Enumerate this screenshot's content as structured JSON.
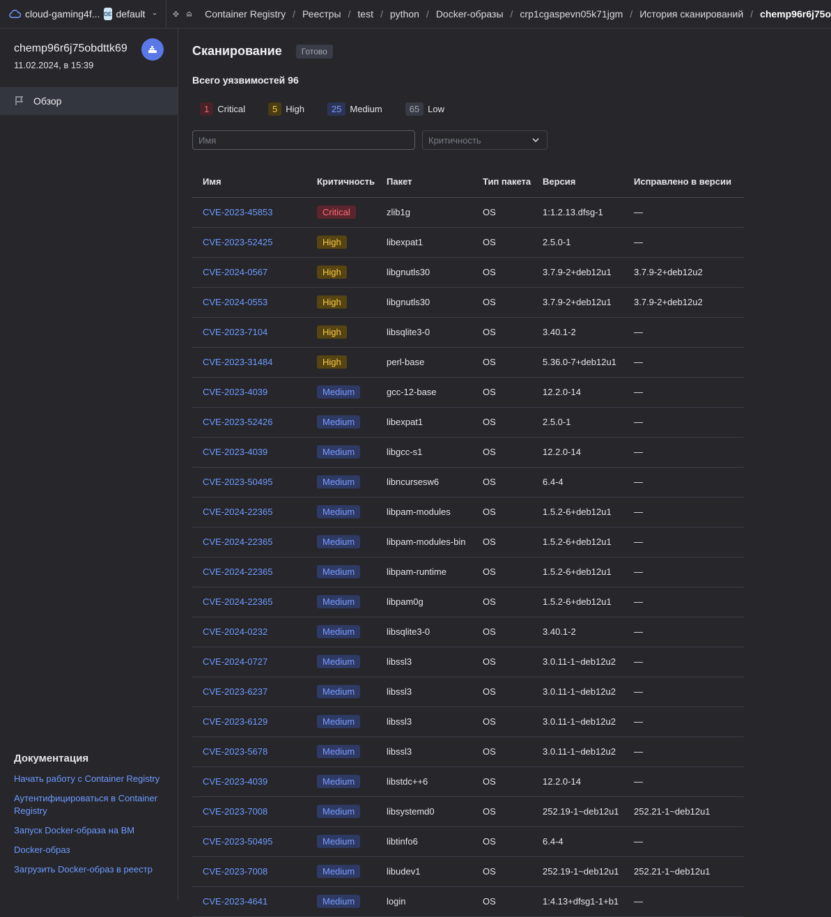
{
  "topbar": {
    "cloud_name": "cloud-gaming4f...",
    "folder_badge": "DE",
    "folder_name": "default",
    "breadcrumbs": [
      "Container Registry",
      "Реестры",
      "test",
      "python",
      "Docker-образы",
      "crp1cgaspevn05k71jgm",
      "История сканирований",
      "chemp96r6j75o"
    ]
  },
  "sidebar": {
    "title": "chemp96r6j75obdttk69",
    "date": "11.02.2024, в 15:39",
    "nav": [
      {
        "label": "Обзор",
        "icon": "flag-icon"
      }
    ],
    "docs": {
      "title": "Документация",
      "links": [
        "Начать работу с Container Registry",
        "Аутентифицироваться в Container Registry",
        "Запуск Docker-образа на ВМ",
        "Docker-образ",
        "Загрузить Docker-образ в реестр"
      ]
    }
  },
  "main": {
    "title": "Сканирование",
    "status": "Готово",
    "total": "Всего уязвимостей 96",
    "counts": [
      {
        "num": "1",
        "label": "Critical",
        "cls": "c-crit"
      },
      {
        "num": "5",
        "label": "High",
        "cls": "c-high"
      },
      {
        "num": "25",
        "label": "Medium",
        "cls": "c-med"
      },
      {
        "num": "65",
        "label": "Low",
        "cls": "c-low"
      }
    ],
    "filters": {
      "name_placeholder": "Имя",
      "severity_placeholder": "Критичность"
    },
    "table": {
      "headers": [
        "Имя",
        "Критичность",
        "Пакет",
        "Тип пакета",
        "Версия",
        "Исправлено в версии"
      ],
      "rows": [
        [
          "CVE-2023-45853",
          "Critical",
          "zlib1g",
          "OS",
          "1:1.2.13.dfsg-1",
          "—"
        ],
        [
          "CVE-2023-52425",
          "High",
          "libexpat1",
          "OS",
          "2.5.0-1",
          "—"
        ],
        [
          "CVE-2024-0567",
          "High",
          "libgnutls30",
          "OS",
          "3.7.9-2+deb12u1",
          "3.7.9-2+deb12u2"
        ],
        [
          "CVE-2024-0553",
          "High",
          "libgnutls30",
          "OS",
          "3.7.9-2+deb12u1",
          "3.7.9-2+deb12u2"
        ],
        [
          "CVE-2023-7104",
          "High",
          "libsqlite3-0",
          "OS",
          "3.40.1-2",
          "—"
        ],
        [
          "CVE-2023-31484",
          "High",
          "perl-base",
          "OS",
          "5.36.0-7+deb12u1",
          "—"
        ],
        [
          "CVE-2023-4039",
          "Medium",
          "gcc-12-base",
          "OS",
          "12.2.0-14",
          "—"
        ],
        [
          "CVE-2023-52426",
          "Medium",
          "libexpat1",
          "OS",
          "2.5.0-1",
          "—"
        ],
        [
          "CVE-2023-4039",
          "Medium",
          "libgcc-s1",
          "OS",
          "12.2.0-14",
          "—"
        ],
        [
          "CVE-2023-50495",
          "Medium",
          "libncursesw6",
          "OS",
          "6.4-4",
          "—"
        ],
        [
          "CVE-2024-22365",
          "Medium",
          "libpam-modules",
          "OS",
          "1.5.2-6+deb12u1",
          "—"
        ],
        [
          "CVE-2024-22365",
          "Medium",
          "libpam-modules-bin",
          "OS",
          "1.5.2-6+deb12u1",
          "—"
        ],
        [
          "CVE-2024-22365",
          "Medium",
          "libpam-runtime",
          "OS",
          "1.5.2-6+deb12u1",
          "—"
        ],
        [
          "CVE-2024-22365",
          "Medium",
          "libpam0g",
          "OS",
          "1.5.2-6+deb12u1",
          "—"
        ],
        [
          "CVE-2024-0232",
          "Medium",
          "libsqlite3-0",
          "OS",
          "3.40.1-2",
          "—"
        ],
        [
          "CVE-2024-0727",
          "Medium",
          "libssl3",
          "OS",
          "3.0.11-1~deb12u2",
          "—"
        ],
        [
          "CVE-2023-6237",
          "Medium",
          "libssl3",
          "OS",
          "3.0.11-1~deb12u2",
          "—"
        ],
        [
          "CVE-2023-6129",
          "Medium",
          "libssl3",
          "OS",
          "3.0.11-1~deb12u2",
          "—"
        ],
        [
          "CVE-2023-5678",
          "Medium",
          "libssl3",
          "OS",
          "3.0.11-1~deb12u2",
          "—"
        ],
        [
          "CVE-2023-4039",
          "Medium",
          "libstdc++6",
          "OS",
          "12.2.0-14",
          "—"
        ],
        [
          "CVE-2023-7008",
          "Medium",
          "libsystemd0",
          "OS",
          "252.19-1~deb12u1",
          "252.21-1~deb12u1"
        ],
        [
          "CVE-2023-50495",
          "Medium",
          "libtinfo6",
          "OS",
          "6.4-4",
          "—"
        ],
        [
          "CVE-2023-7008",
          "Medium",
          "libudev1",
          "OS",
          "252.19-1~deb12u1",
          "252.21-1~deb12u1"
        ],
        [
          "CVE-2023-4641",
          "Medium",
          "login",
          "OS",
          "1:4.13+dfsg1-1+b1",
          "—"
        ]
      ]
    }
  },
  "colors": {
    "background": "#26262b",
    "link": "#6f9cff",
    "critical": "#ff6b78",
    "high": "#f5c842",
    "medium": "#7d9cff",
    "low": "#a3a7b2"
  }
}
